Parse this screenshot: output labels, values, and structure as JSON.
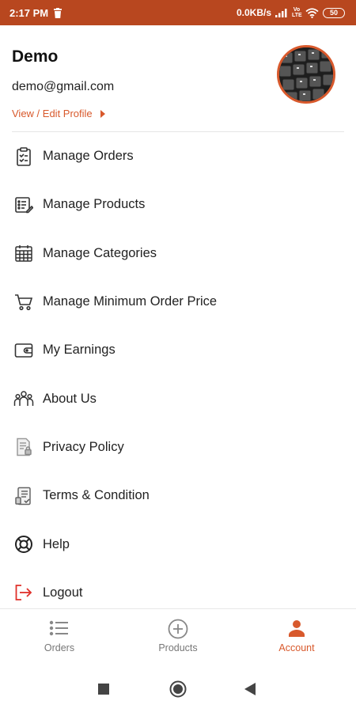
{
  "status_bar": {
    "time": "2:17 PM",
    "net_speed": "0.0KB/s",
    "network_label": "Vo LTE",
    "battery": "50",
    "icons": [
      "trash-icon",
      "signal-icon",
      "wifi-icon",
      "battery-icon"
    ]
  },
  "profile": {
    "name": "Demo",
    "email": "demo@gmail.com",
    "edit_link": "View / Edit Profile",
    "avatar_icon": "keyboard-photo"
  },
  "menu": {
    "items": [
      {
        "label": "Manage Orders",
        "icon": "clipboard-check-icon"
      },
      {
        "label": "Manage Products",
        "icon": "product-list-icon"
      },
      {
        "label": "Manage Categories",
        "icon": "calendar-grid-icon"
      },
      {
        "label": "Manage Minimum Order Price",
        "icon": "cart-icon"
      },
      {
        "label": "My Earnings",
        "icon": "wallet-icon"
      },
      {
        "label": "About Us",
        "icon": "group-icon"
      },
      {
        "label": "Privacy Policy",
        "icon": "document-lock-icon"
      },
      {
        "label": "Terms & Condition",
        "icon": "terms-document-icon"
      },
      {
        "label": "Help",
        "icon": "lifebuoy-icon"
      },
      {
        "label": "Logout",
        "icon": "logout-icon"
      }
    ]
  },
  "bottom_nav": {
    "tabs": [
      {
        "label": "Orders",
        "icon": "list-icon",
        "active": false
      },
      {
        "label": "Products",
        "icon": "add-circle-icon",
        "active": false
      },
      {
        "label": "Account",
        "icon": "person-icon",
        "active": true
      }
    ]
  },
  "colors": {
    "status_bar": "#b8471f",
    "accent": "#d8592c",
    "logout_red": "#e0302a"
  }
}
